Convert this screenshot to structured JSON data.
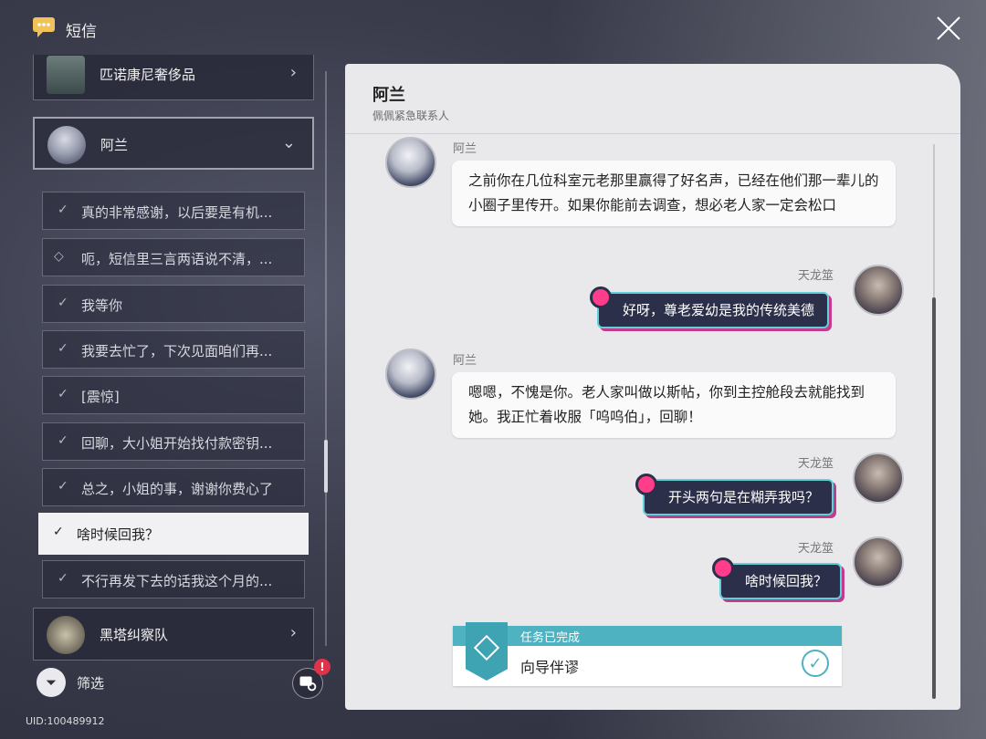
{
  "app": {
    "title": "短信",
    "uid": "UID:100489912"
  },
  "sidebar": {
    "contacts": [
      {
        "name": "匹诺康尼奢侈品"
      },
      {
        "name": "阿兰"
      },
      {
        "name": "黑塔纠察队"
      }
    ],
    "messages": [
      {
        "text": "真的非常感谢，以后要是有机..."
      },
      {
        "text": "呃，短信里三言两语说不清，..."
      },
      {
        "text": "我等你"
      },
      {
        "text": "我要去忙了，下次见面咱们再..."
      },
      {
        "text": "[震惊]"
      },
      {
        "text": "回聊，大小姐开始找付款密钥..."
      },
      {
        "text": "总之，小姐的事，谢谢你费心了"
      },
      {
        "text": "啥时候回我？"
      },
      {
        "text": "不行再发下去的话我这个月的..."
      }
    ],
    "filter_label": "筛选",
    "badge": "!"
  },
  "chat": {
    "contact_name": "阿兰",
    "contact_subtitle": "佩佩紧急联系人",
    "messages": [
      {
        "sender": "阿兰",
        "text": "之前你在几位科室元老那里赢得了好名声，已经在他们那一辈儿的小圈子里传开。如果你能前去调查，想必老人家一定会松口"
      },
      {
        "sender": "天龙筮",
        "text": "好呀，尊老爱幼是我的传统美德"
      },
      {
        "sender": "阿兰",
        "text": "嗯嗯，不愧是你。老人家叫做以斯帖，你到主控舱段去就能找到她。我正忙着收服「呜呜伯」，回聊！"
      },
      {
        "sender": "天龙筮",
        "text": "开头两句是在糊弄我吗？"
      },
      {
        "sender": "天龙筮",
        "text": "啥时候回我？"
      }
    ],
    "quest": {
      "status": "任务已完成",
      "name": "向导伴谬"
    }
  },
  "colors": {
    "accent": "#4fb2c0",
    "sticker_pink": "#ff3d8a",
    "badge_red": "#e0334a"
  }
}
